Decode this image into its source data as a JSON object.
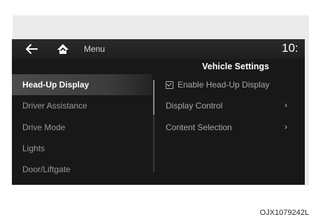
{
  "topbar": {
    "back_icon": "back-arrow-icon",
    "home_icon": "home-icon",
    "menu_label": "Menu",
    "clock": "10:"
  },
  "header": {
    "title": "Vehicle Settings"
  },
  "sidebar": {
    "items": [
      {
        "label": "Head-Up Display",
        "active": true
      },
      {
        "label": "Driver Assistance",
        "active": false
      },
      {
        "label": "Drive Mode",
        "active": false
      },
      {
        "label": "Lights",
        "active": false
      },
      {
        "label": "Door/Liftgate",
        "active": false
      }
    ]
  },
  "content": {
    "options": [
      {
        "label": "Enable Head-Up Display",
        "type": "checkbox",
        "checked": true
      },
      {
        "label": "Display Control",
        "type": "submenu",
        "chevron": "›"
      },
      {
        "label": "Content Selection",
        "type": "submenu",
        "chevron": "›"
      }
    ]
  },
  "caption": "OJX1079242L",
  "colors": {
    "screen_bg": "#181818",
    "frame_bg": "#ebebeb",
    "active_item_bg": "#4c4c4c",
    "text_primary": "#ffffff",
    "text_secondary": "#9a9a9a"
  }
}
